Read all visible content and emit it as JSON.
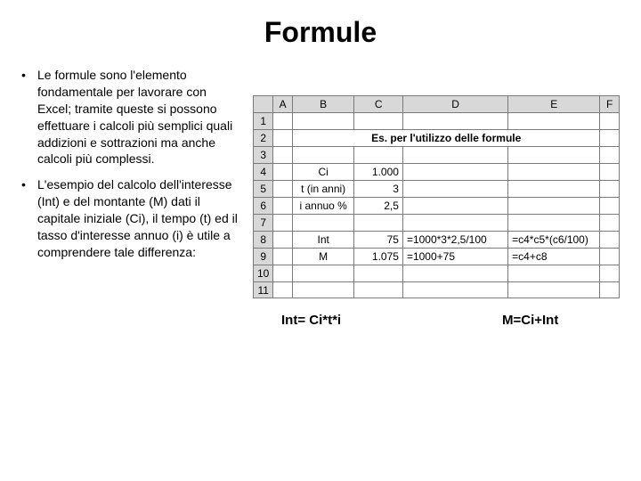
{
  "title": "Formule",
  "bullets": [
    "Le formule sono l'elemento fondamentale per lavorare con Excel; tramite queste si possono effettuare i calcoli più semplici quali addizioni e sottrazioni  ma anche calcoli più complessi.",
    "L'esempio del calcolo dell'interesse (Int) e del montante  (M) dati il capitale iniziale (Ci), il tempo (t) ed il tasso d'interesse annuo (i) è utile a comprendere tale differenza:"
  ],
  "sheet": {
    "cols": [
      "A",
      "B",
      "C",
      "D",
      "E",
      "F"
    ],
    "merged_heading": "Es. per l'utilizzo delle formule",
    "rows": {
      "r4_b": "Ci",
      "r4_c": "1.000",
      "r5_b": "t (in anni)",
      "r5_c": "3",
      "r6_b": "i annuo %",
      "r6_c": "2,5",
      "r8_b": "Int",
      "r8_c": "75",
      "r8_d": "=1000*3*2,5/100",
      "r8_e": "=c4*c5*(c6/100)",
      "r9_b": "M",
      "r9_c": "1.075",
      "r9_d": "=1000+75",
      "r9_e": "=c4+c8"
    }
  },
  "formulas": {
    "f1": "Int= Ci*t*i",
    "f2": "M=Ci+Int"
  }
}
